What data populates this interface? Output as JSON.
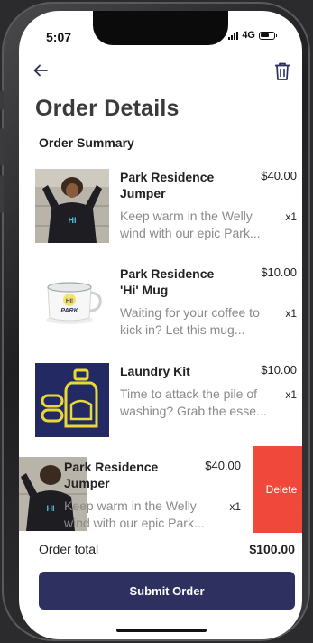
{
  "status_bar": {
    "time": "5:07",
    "network": "4G"
  },
  "header": {
    "back_icon": "arrow-left-icon",
    "delete_icon": "trash-icon",
    "title": "Order Details"
  },
  "summary": {
    "title": "Order Summary",
    "items": [
      {
        "name": "Park Residence Jumper",
        "price": "$40.00",
        "description": "Keep warm in the Welly wind with our epic Park...",
        "qty": "x1",
        "image": "person-in-hoodie-photo"
      },
      {
        "name": "Park Residence 'Hi' Mug",
        "price": "$10.00",
        "description": "Waiting for your coffee to kick in? Let this mug...",
        "qty": "x1",
        "image": "enamel-mug-photo"
      },
      {
        "name": "Laundry Kit",
        "price": "$10.00",
        "description": "Time to attack the pile of washing?  Grab the esse...",
        "qty": "x1",
        "image": "laundry-bottle-illustration"
      },
      {
        "name": "Park Residence Jumper",
        "price": "$40.00",
        "description": "Keep warm in the Welly wind with our epic Park...",
        "qty": "x1",
        "image": "person-in-hoodie-photo"
      }
    ],
    "swipe_delete_label": "Delete"
  },
  "footer": {
    "total_label": "Order total",
    "total_value": "$100.00",
    "submit_label": "Submit Order"
  },
  "colors": {
    "primary": "#2e3160",
    "delete": "#f0483a",
    "muted_text": "#8a8a8a",
    "laundry_bg": "#232a63",
    "laundry_fg": "#e8d93a"
  }
}
